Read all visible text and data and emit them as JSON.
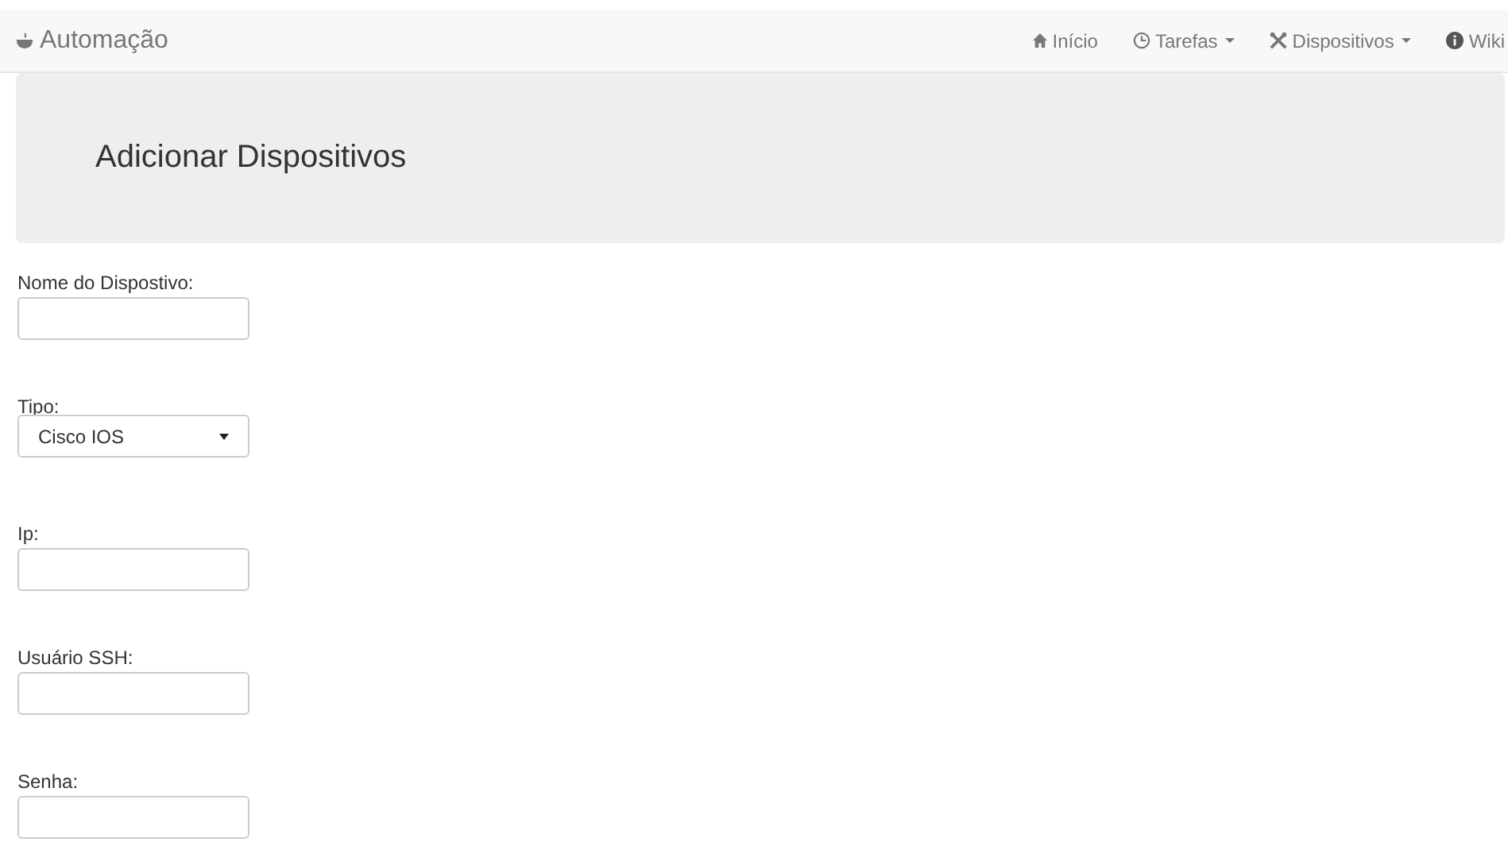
{
  "navbar": {
    "brand": "Automação",
    "items": [
      {
        "label": "Início",
        "dropdown": false
      },
      {
        "label": "Tarefas",
        "dropdown": true
      },
      {
        "label": "Dispositivos",
        "dropdown": true
      },
      {
        "label": "Wiki",
        "dropdown": false
      }
    ]
  },
  "header": {
    "title": "Adicionar Dispositivos"
  },
  "form": {
    "fields": [
      {
        "label": "Nome do Dispostivo:",
        "kind": "text"
      },
      {
        "label": "Tipo:",
        "kind": "select",
        "value": "Cisco IOS"
      },
      {
        "label": "Ip:",
        "kind": "text"
      },
      {
        "label": "Usuário SSH:",
        "kind": "text"
      },
      {
        "label": "Senha:",
        "kind": "password"
      }
    ]
  }
}
